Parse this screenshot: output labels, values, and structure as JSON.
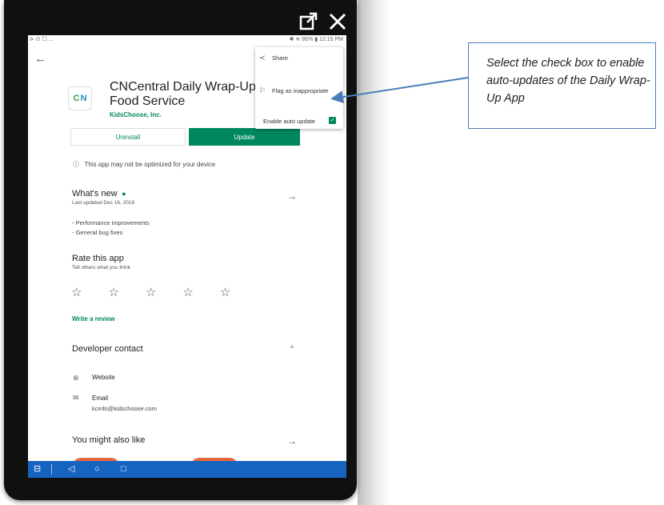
{
  "status_bar": {
    "left": "⊳ ⊙ ☐ ...",
    "right": "✱ ≋ 86% ▮ 12:15 PM"
  },
  "overflow_menu": {
    "items": [
      {
        "label": "Share",
        "icon": "share-icon"
      },
      {
        "label": "Flag as inappropriate",
        "icon": "flag-icon"
      },
      {
        "label": "Enable auto update",
        "checked": true
      }
    ]
  },
  "app": {
    "title_line1": "CNCentral Daily Wrap-Up fo",
    "title_line2": "Food Service",
    "developer": "KidsChoose, Inc.",
    "icon_letters": [
      "C",
      "N"
    ]
  },
  "buttons": {
    "uninstall": "Uninstall",
    "update": "Update"
  },
  "warning": "This app may not be optimized for your device",
  "whats_new": {
    "title": "What's new",
    "updated": "Last updated Dec 16, 2019",
    "notes": [
      "- Performance improvements",
      "- General bug fixes"
    ]
  },
  "rate": {
    "title": "Rate this app",
    "subtitle": "Tell others what you think",
    "stars": 5,
    "write_review": "Write a review"
  },
  "developer_contact": {
    "title": "Developer contact",
    "website_label": "Website",
    "email_label": "Email",
    "email_value": "kcinfo@kidschoose.com"
  },
  "also_like": "You might also like",
  "callout": "Select the check box to enable auto-updates of the Daily Wrap-Up App",
  "colors": {
    "accent": "#01875f",
    "navbar": "#1565c0",
    "callout_border": "#4a7ebb",
    "orange": "#e8653a"
  }
}
